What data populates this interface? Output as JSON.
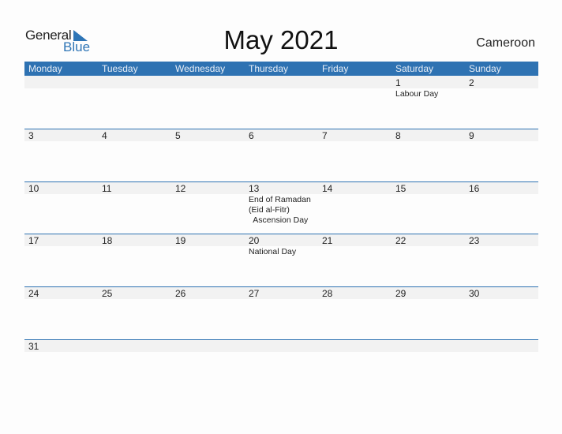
{
  "logo": {
    "general": "General",
    "blue": "Blue"
  },
  "title": "May 2021",
  "country": "Cameroon",
  "colors": {
    "accent": "#2e72b2",
    "band": "#f2f2f2"
  },
  "weekdays": [
    "Monday",
    "Tuesday",
    "Wednesday",
    "Thursday",
    "Friday",
    "Saturday",
    "Sunday"
  ],
  "weeks": [
    [
      {
        "day": ""
      },
      {
        "day": ""
      },
      {
        "day": ""
      },
      {
        "day": ""
      },
      {
        "day": ""
      },
      {
        "day": "1",
        "events": [
          "Labour Day"
        ]
      },
      {
        "day": "2"
      }
    ],
    [
      {
        "day": "3"
      },
      {
        "day": "4"
      },
      {
        "day": "5"
      },
      {
        "day": "6"
      },
      {
        "day": "7"
      },
      {
        "day": "8"
      },
      {
        "day": "9"
      }
    ],
    [
      {
        "day": "10"
      },
      {
        "day": "11"
      },
      {
        "day": "12"
      },
      {
        "day": "13",
        "events": [
          "End of Ramadan",
          "(Eid al-Fitr)",
          "  Ascension Day"
        ]
      },
      {
        "day": "14"
      },
      {
        "day": "15"
      },
      {
        "day": "16"
      }
    ],
    [
      {
        "day": "17"
      },
      {
        "day": "18"
      },
      {
        "day": "19"
      },
      {
        "day": "20",
        "events": [
          "National Day"
        ]
      },
      {
        "day": "21"
      },
      {
        "day": "22"
      },
      {
        "day": "23"
      }
    ],
    [
      {
        "day": "24"
      },
      {
        "day": "25"
      },
      {
        "day": "26"
      },
      {
        "day": "27"
      },
      {
        "day": "28"
      },
      {
        "day": "29"
      },
      {
        "day": "30"
      }
    ],
    [
      {
        "day": "31"
      },
      {
        "day": ""
      },
      {
        "day": ""
      },
      {
        "day": ""
      },
      {
        "day": ""
      },
      {
        "day": ""
      },
      {
        "day": ""
      }
    ]
  ]
}
